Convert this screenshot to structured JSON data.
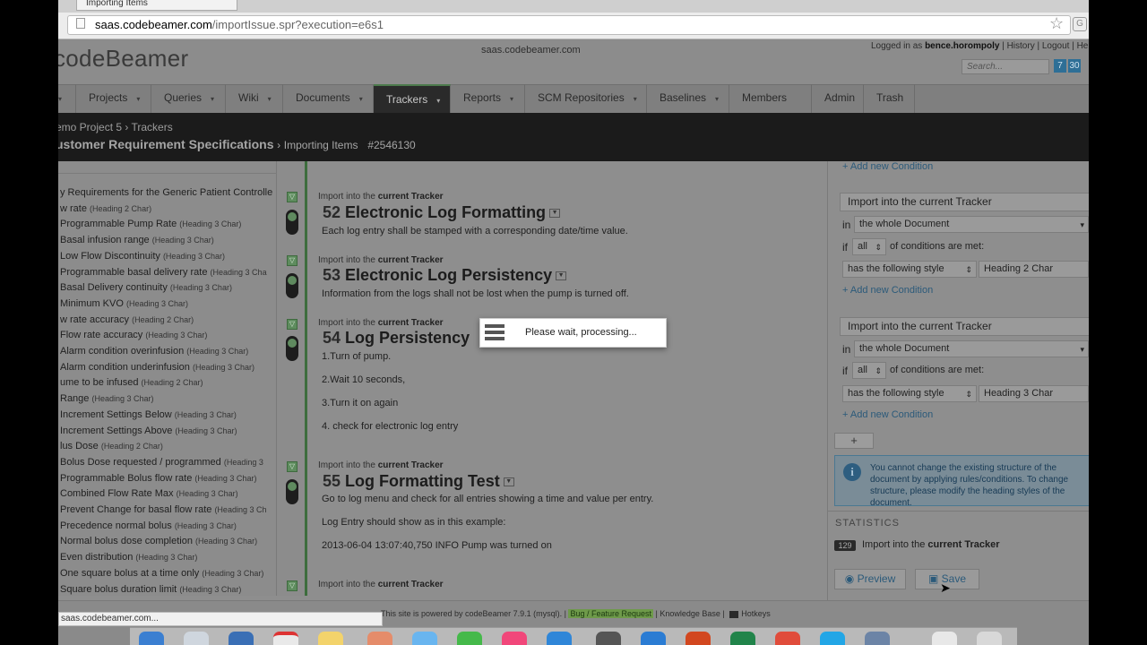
{
  "browser": {
    "tab_title": "Importing Items",
    "url_domain": "saas.codebeamer.com",
    "url_path": "/importIssue.spr?execution=e6s1",
    "ext_label": "G"
  },
  "header": {
    "logo": "codeBeamer",
    "site": "saas.codebeamer.com",
    "logged_in_prefix": "Logged in as",
    "username": "bence.horompoly",
    "links": "| History | Logout | Help",
    "search_placeholder": "Search...",
    "badge1": "7",
    "badge2": "30"
  },
  "nav": {
    "items": [
      "Projects",
      "Queries",
      "Wiki",
      "Documents",
      "Trackers",
      "Reports",
      "SCM Repositories",
      "Baselines",
      "Members",
      "Admin",
      "Trash"
    ],
    "arrow": "▾"
  },
  "breadcrumb": {
    "line1": "emo Project 5 › Trackers",
    "tracker": "ustomer Requirement Specifications",
    "sep": "›",
    "item": "Importing Items",
    "id": "#2546130"
  },
  "outline": [
    {
      "text": "y Requirements for the Generic Patient Controlle",
      "style": ""
    },
    {
      "text": "w rate",
      "style": "(Heading 2 Char)"
    },
    {
      "text": "Programmable Pump Rate",
      "style": "(Heading 3 Char)"
    },
    {
      "text": "Basal infusion range",
      "style": "(Heading 3 Char)"
    },
    {
      "text": "Low Flow Discontinuity",
      "style": "(Heading 3 Char)"
    },
    {
      "text": "Programmable basal delivery rate",
      "style": "(Heading 3 Cha"
    },
    {
      "text": "Basal Delivery continuity",
      "style": "(Heading 3 Char)"
    },
    {
      "text": "Minimum KVO",
      "style": "(Heading 3 Char)"
    },
    {
      "text": "w rate accuracy",
      "style": "(Heading 2 Char)"
    },
    {
      "text": "Flow rate accuracy",
      "style": "(Heading 3 Char)"
    },
    {
      "text": "Alarm condition overinfusion",
      "style": "(Heading 3 Char)"
    },
    {
      "text": "Alarm condition underinfusion",
      "style": "(Heading 3 Char)"
    },
    {
      "text": "ume to be infused",
      "style": "(Heading 2 Char)"
    },
    {
      "text": "Range",
      "style": "(Heading 3 Char)"
    },
    {
      "text": "Increment Settings Below",
      "style": "(Heading 3 Char)"
    },
    {
      "text": "Increment Settings Above",
      "style": "(Heading 3 Char)"
    },
    {
      "text": "lus Dose",
      "style": "(Heading 2 Char)"
    },
    {
      "text": "Bolus Dose requested / programmed",
      "style": "(Heading 3"
    },
    {
      "text": "Programmable Bolus flow rate",
      "style": "(Heading 3 Char)"
    },
    {
      "text": "Combined Flow Rate Max",
      "style": "(Heading 3 Char)"
    },
    {
      "text": "Prevent Change for basal flow rate",
      "style": "(Heading 3 Ch"
    },
    {
      "text": "Precedence normal bolus",
      "style": "(Heading 3 Char)"
    },
    {
      "text": "Normal bolus dose completion",
      "style": "(Heading 3 Char)"
    },
    {
      "text": "Even distribution",
      "style": "(Heading 3 Char)"
    },
    {
      "text": "One square bolus at a time only",
      "style": "(Heading 3 Char)"
    },
    {
      "text": "Square bolus duration limit",
      "style": "(Heading 3 Char)"
    }
  ],
  "doc": {
    "import_prefix": "Import into the",
    "import_target": "current Tracker",
    "items": [
      {
        "num": "52",
        "title": "Electronic Log Formatting",
        "lines": [
          "Each log entry shall be stamped with a corresponding date/time value."
        ]
      },
      {
        "num": "53",
        "title": "Electronic Log Persistency",
        "lines": [
          "Information from the logs shall not be lost when the pump is turned off."
        ]
      },
      {
        "num": "54",
        "title": "Log Persistency",
        "lines": [
          "1.Turn of pump.",
          "2.Wait 10 seconds,",
          "3.Turn it on again",
          "4. check for electronic log entry"
        ]
      },
      {
        "num": "55",
        "title": "Log Formatting Test",
        "lines": [
          "Go to log menu and check for all entries showing a time and value per entry.",
          "Log Entry should show as in this example:",
          "2013-06-04 13:07:40,750 INFO Pump was turned on"
        ]
      }
    ]
  },
  "rules": {
    "add_condition": "+ Add new Condition",
    "target": "Import into the current Tracker",
    "in_label": "in",
    "scope": "the whole Document",
    "if_label": "if",
    "all": "all",
    "conditions_met": "of conditions are met:",
    "has_style": "has the following style",
    "style1": "Heading 2 Char",
    "style2": "Heading 3 Char",
    "plus": "+",
    "info": "You cannot change the existing structure of the document by applying rules/conditions. To change structure, please modify the heading styles of the document."
  },
  "statistics": {
    "label": "STATISTICS",
    "count": "129",
    "text_prefix": "Import into the",
    "text_target": "current Tracker"
  },
  "actions": {
    "preview": "Preview",
    "save": "Save"
  },
  "overlay": {
    "message": "Please wait, processing..."
  },
  "footer": {
    "powered": "This site is powered by codeBeamer 7.9.1 (mysql).",
    "bug": "Bug / Feature Request",
    "kb": "| Knowledge Base |",
    "hotkeys": "Hotkeys"
  },
  "statusbar": "saas.codebeamer.com..."
}
